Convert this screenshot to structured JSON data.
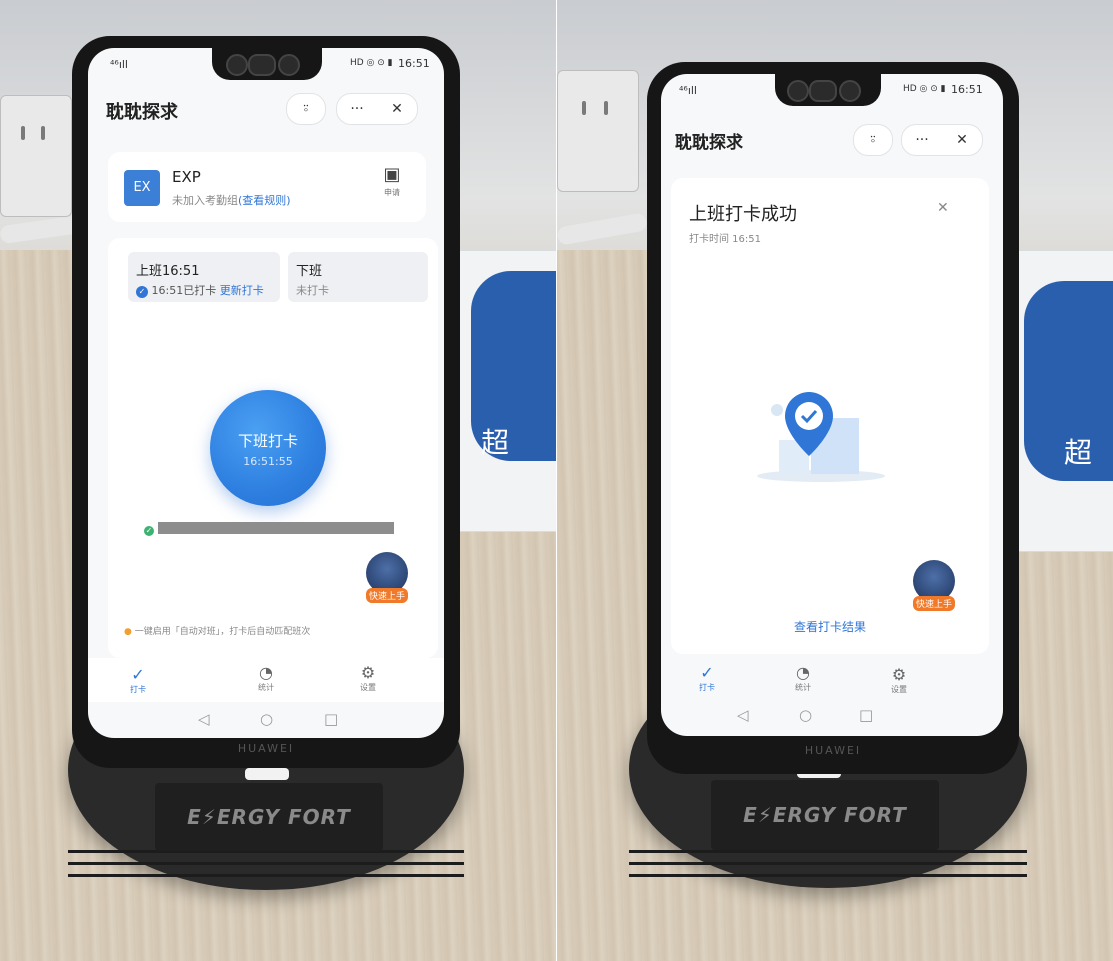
{
  "left_photo": {
    "app_title": "耽耽探求",
    "status": {
      "signal": "⁴⁶ıll",
      "time": "16:51",
      "icons": "HD ◎ ⊙ ▮"
    },
    "title_buttons": {
      "support": "⍤",
      "more": "···",
      "close": "✕"
    },
    "group_card": {
      "badge": "EX",
      "name": "EXP",
      "desc_prefix": "未加入考勤组",
      "desc_link": "(查看规则)",
      "apply_label": "申请"
    },
    "shifts": [
      {
        "title": "上班16:51",
        "status": "16:51已打卡",
        "action": "更新打卡"
      },
      {
        "title": "下班",
        "status": "未打卡"
      }
    ],
    "clock_button": {
      "label": "下班打卡",
      "time": "16:51:55"
    },
    "hint": "一键启用「自动对班」，打卡后自动匹配班次",
    "assistant_tag": "快速上手",
    "tabs": [
      {
        "label": "打卡",
        "icon": "✓"
      },
      {
        "label": "统计",
        "icon": "◔"
      },
      {
        "label": "设置",
        "icon": "⚙"
      }
    ],
    "phone_brand": "HUAWEI",
    "dock_brand": "E⚡ERGY FORT"
  },
  "right_photo": {
    "app_title": "耽耽探求",
    "status": {
      "signal": "⁴⁶ıll",
      "time": "16:51",
      "icons": "HD ◎ ⊙ ▮"
    },
    "title_buttons": {
      "support": "⍤",
      "more": "···",
      "close": "✕"
    },
    "result_card": {
      "title": "上班打卡成功",
      "subtitle": "打卡时间 16:51",
      "close": "✕",
      "link": "查看打卡结果"
    },
    "assistant_tag": "快速上手",
    "tabs": [
      {
        "label": "打卡",
        "icon": "✓"
      },
      {
        "label": "统计",
        "icon": "◔"
      },
      {
        "label": "设置",
        "icon": "⚙"
      }
    ],
    "phone_brand": "HUAWEI",
    "dock_brand": "E⚡ERGY FORT"
  },
  "colors": {
    "accent": "#2f76d6",
    "success": "#3cb371",
    "tag": "#f07a2a"
  }
}
